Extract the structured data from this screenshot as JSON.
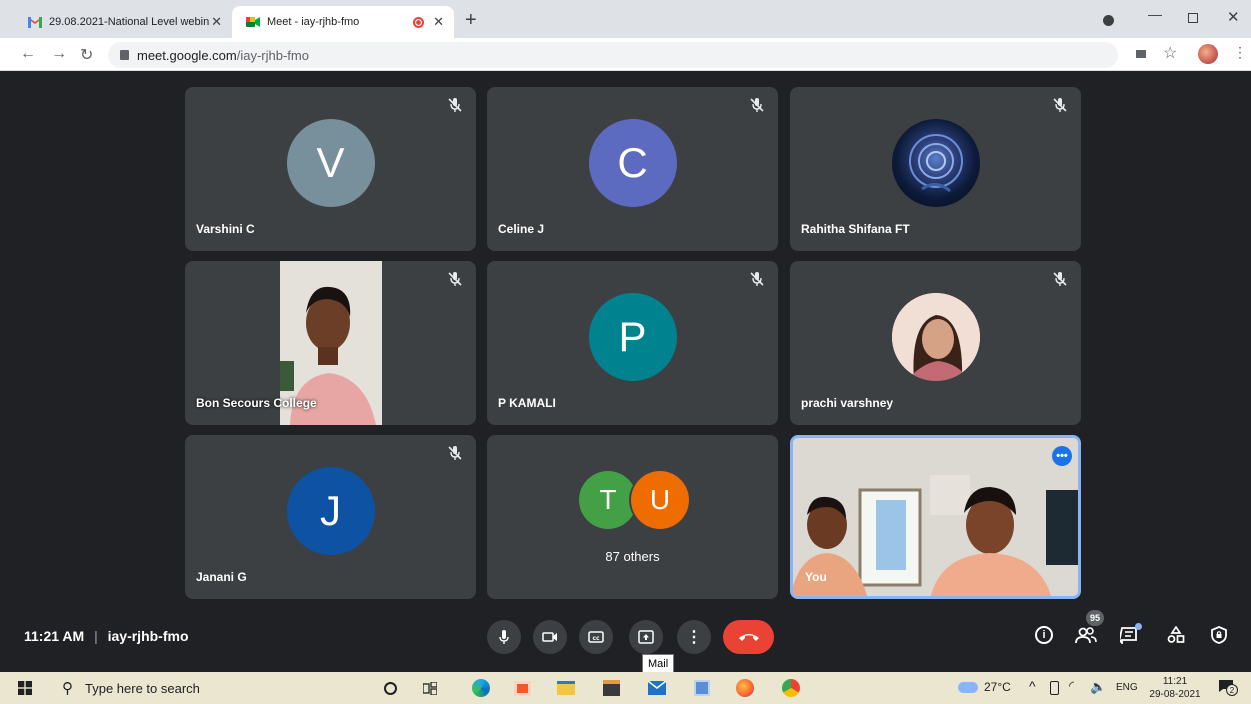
{
  "browser": {
    "tabs": [
      {
        "title": "29.08.2021-National Level webin",
        "active": false
      },
      {
        "title": "Meet - iay-rjhb-fmo",
        "active": true
      }
    ],
    "url_host": "meet.google.com",
    "url_path": "/iay-rjhb-fmo"
  },
  "participants": [
    {
      "name": "Varshini C",
      "initial": "V",
      "avatar_color": "#78909c",
      "kind": "letter",
      "muted": true
    },
    {
      "name": "Celine J",
      "initial": "C",
      "avatar_color": "#5c6bc0",
      "kind": "letter",
      "muted": true
    },
    {
      "name": "Rahitha Shifana FT",
      "initial": "",
      "avatar_color": "#0d1b3a",
      "kind": "rose",
      "muted": true
    },
    {
      "name": "Bon Secours College",
      "initial": "",
      "avatar_color": "#c98a6c",
      "kind": "video",
      "muted": true
    },
    {
      "name": "P KAMALI",
      "initial": "P",
      "avatar_color": "#00838f",
      "kind": "letter",
      "muted": true
    },
    {
      "name": "prachi varshney",
      "initial": "",
      "avatar_color": "#e8c2b0",
      "kind": "face",
      "muted": true
    },
    {
      "name": "Janani G",
      "initial": "J",
      "avatar_color": "#0d52a3",
      "kind": "letter",
      "muted": true
    }
  ],
  "others": {
    "label": "87 others",
    "initials": [
      "T",
      "U"
    ],
    "colors": [
      "#43a047",
      "#ef6c00"
    ]
  },
  "self": {
    "name": "You"
  },
  "meeting": {
    "time": "11:21 AM",
    "code": "iay-rjhb-fmo",
    "participant_count": "95"
  },
  "tooltip": "Mail",
  "taskbar": {
    "search_placeholder": "Type here to search",
    "temperature": "27°C",
    "language": "ENG",
    "clock_time": "11:21",
    "clock_date": "29-08-2021",
    "notification_count": "2"
  },
  "colors": {
    "hangup": "#ea4335",
    "self_border": "#8ab4f8"
  }
}
